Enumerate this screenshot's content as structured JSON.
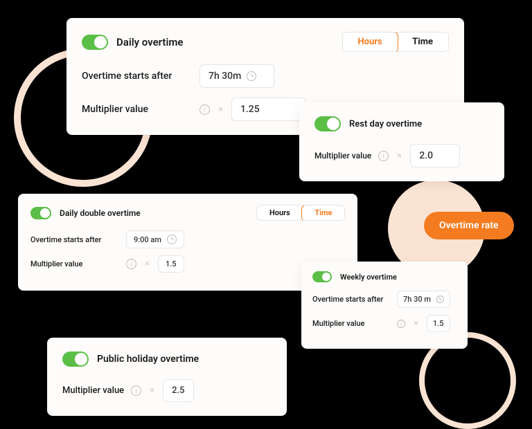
{
  "common": {
    "overtime_starts_after": "Overtime starts after",
    "multiplier_value": "Multiplier value",
    "times": "×"
  },
  "segmented": {
    "hours": "Hours",
    "time": "Time"
  },
  "cards": {
    "daily": {
      "title": "Daily overtime",
      "active_segment": "hours",
      "starts_after": "7h 30m",
      "multiplier": "1.25"
    },
    "rest": {
      "title": "Rest day overtime",
      "multiplier": "2.0"
    },
    "double": {
      "title": "Daily double overtime",
      "active_segment": "time",
      "starts_after": "9:00 am",
      "multiplier": "1.5"
    },
    "weekly": {
      "title": "Weekly overtime",
      "starts_after": "7h 30 m",
      "multiplier": "1.5"
    },
    "public": {
      "title": "Public holiday overtime",
      "multiplier": "2.5"
    }
  },
  "pill": {
    "rate": "Overtime rate"
  }
}
